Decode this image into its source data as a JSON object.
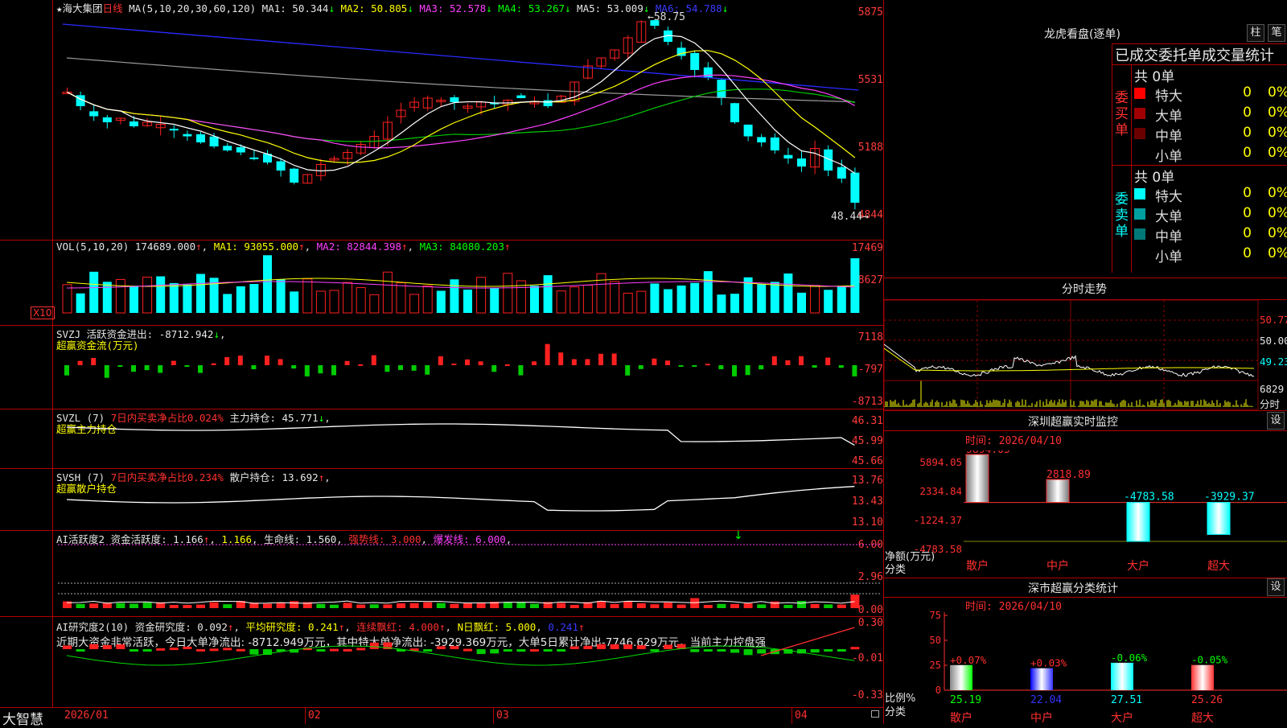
{
  "main": {
    "title_star": "★",
    "stock_name": "海大集团",
    "period": "日线",
    "ma_params": "MA(5,10,20,30,60,120)",
    "ma": [
      {
        "label": "MA1: ",
        "value": "50.344",
        "arrow": "↓",
        "color": "#e6e6e6"
      },
      {
        "label": "MA2: ",
        "value": "50.805",
        "arrow": "↓",
        "color": "#ffff00"
      },
      {
        "label": "MA3: ",
        "value": "52.578",
        "arrow": "↓",
        "color": "#ff40ff"
      },
      {
        "label": "MA4: ",
        "value": "53.267",
        "arrow": "↓",
        "color": "#00ff00"
      },
      {
        "label": "MA5: ",
        "value": "53.009",
        "arrow": "↓",
        "color": "#e6e6e6"
      },
      {
        "label": "MA6: ",
        "value": "54.788",
        "arrow": "↓",
        "color": "#3a3aff"
      }
    ],
    "y_labels": [
      "5875",
      "5531",
      "5188",
      "4844"
    ],
    "high_marker": "58.75",
    "low_marker": "48.44"
  },
  "vol": {
    "label": "VOL(5,10,20)",
    "value": "174689.000",
    "ma1": "MA1: 93055.000",
    "ma2": "MA2: 82844.398",
    "ma3": "MA3: 84080.203",
    "y_labels": [
      "17469",
      "8627"
    ],
    "unit_badge": "X10"
  },
  "svzj": {
    "name": "SVZJ",
    "field": "活跃资金进出: -8712.942",
    "subtitle": "超赢资金流(万元)",
    "y_labels": [
      "7118",
      "-797",
      "-8713"
    ]
  },
  "svzl": {
    "name": "SVZL (7)",
    "ratio": "7日内买卖净占比0.024%",
    "holding": "主力持仓: 45.771",
    "subtitle": "超赢主力持仓",
    "y_labels": [
      "46.31",
      "45.99",
      "45.66"
    ]
  },
  "svsh": {
    "name": "SVSH (7)",
    "ratio": "7日内买卖净占比0.234%",
    "holding": "散户持仓: 13.692",
    "subtitle": "超赢散户持仓",
    "y_labels": [
      "13.76",
      "13.43",
      "13.10"
    ]
  },
  "ai1": {
    "name": "AI活跃度2",
    "field1": "资金活跃度: 1.166",
    "field2": "1.166",
    "field3": "生命线: 1.560",
    "field4": "强势线: 3.000",
    "field5": "爆发线: 6.000",
    "y_labels": [
      "6.00",
      "2.96",
      "0.00"
    ]
  },
  "ai2": {
    "name": "AI研究度2(10)",
    "field1": "资金研究度: 0.092",
    "field2": "平均研究度: 0.241",
    "field3": "连续飘红: 4.000",
    "field4": "N日飘红: 5.000",
    "field5": "0.241",
    "comment": "近期大资金非常活跃，今日大单净流出: -8712.949万元，其中特大单净流出: -3929.369万元，大单5日累计净出-7746.629万元，当前主力控盘强",
    "y_labels": [
      "0.30",
      "-0.01",
      "-0.33"
    ]
  },
  "xaxis": {
    "brand": "大智慧",
    "dates": [
      "2026/01",
      "02",
      "03",
      "04"
    ]
  },
  "longhu": {
    "title": "龙虎看盘(逐单)",
    "tabs": [
      "柱",
      "笔"
    ],
    "heading": "已成交委托单成交量统计",
    "buy_side": "委买单",
    "sell_side": "委卖单",
    "buy_total": "共 0单",
    "sell_total": "共 0单",
    "buy_rows": [
      {
        "name": "特大",
        "count": "0",
        "pct": "0%",
        "color": "#ff0000"
      },
      {
        "name": "大单",
        "count": "0",
        "pct": "0%",
        "color": "#a00000"
      },
      {
        "name": "中单",
        "count": "0",
        "pct": "0%",
        "color": "#6a0000"
      },
      {
        "name": "小单",
        "count": "0",
        "pct": "0%",
        "color": ""
      }
    ],
    "sell_rows": [
      {
        "name": "特大",
        "count": "0",
        "pct": "0%",
        "color": "#00ffff"
      },
      {
        "name": "大单",
        "count": "0",
        "pct": "0%",
        "color": "#00a0a0"
      },
      {
        "name": "中单",
        "count": "0",
        "pct": "0%",
        "color": "#007878"
      },
      {
        "name": "小单",
        "count": "0",
        "pct": "0%",
        "color": ""
      }
    ]
  },
  "intraday": {
    "title": "分时走势",
    "y_labels": [
      "50.77",
      "50.00",
      "49.23"
    ],
    "vol_label": "6829",
    "vol_unit": "分时"
  },
  "realtime": {
    "title": "深圳超赢实时监控",
    "settings": "设",
    "time": "时间: 2026/04/10",
    "y_labels": [
      "5894.05",
      "2334.84",
      "-1224.37",
      "-4783.58"
    ],
    "bars": [
      {
        "value": 5894.05,
        "label": "5894.05",
        "cat": "散户"
      },
      {
        "value": 2818.89,
        "label": "2818.89",
        "cat": "中户"
      },
      {
        "value": -4783.58,
        "label": "-4783.58",
        "cat": "大户"
      },
      {
        "value": -3929.37,
        "label": "-3929.37",
        "cat": "超大"
      }
    ],
    "axis_name1": "净额(万元)",
    "axis_name2": "分类"
  },
  "classify": {
    "title": "深市超赢分类统计",
    "settings": "设",
    "time": "时间: 2026/04/10",
    "y_labels": [
      "75",
      "50",
      "25",
      "0"
    ],
    "bars": [
      {
        "change": "+0.07%",
        "value": 25.19,
        "label": "25.19",
        "cat": "散户"
      },
      {
        "change": "+0.03%",
        "value": 22.04,
        "label": "22.04",
        "cat": "中户"
      },
      {
        "change": "-0.06%",
        "value": 27.51,
        "label": "27.51",
        "cat": "大户"
      },
      {
        "change": "-0.05%",
        "value": 25.26,
        "label": "25.26",
        "cat": "超大"
      }
    ],
    "axis_name1": "比例%",
    "axis_name2": "分类"
  }
}
